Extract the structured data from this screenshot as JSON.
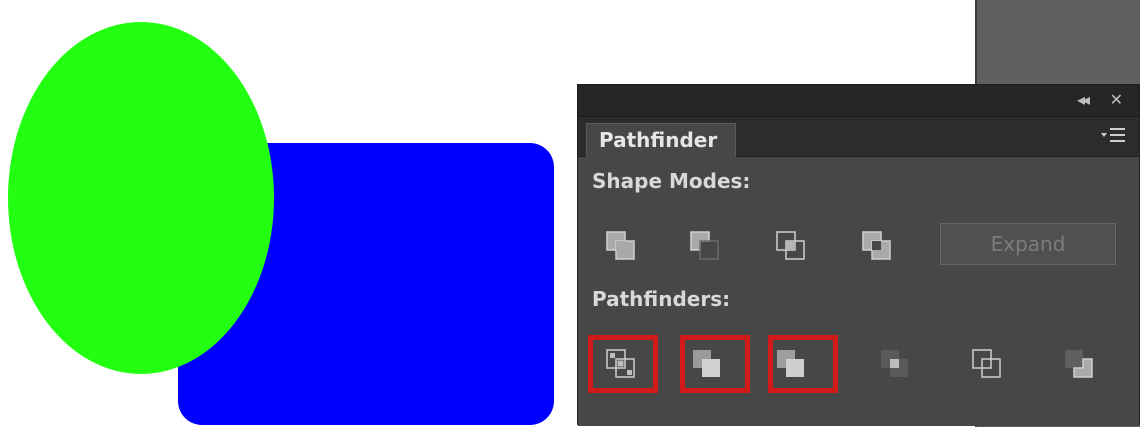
{
  "panel": {
    "tab_label": "Pathfinder",
    "shape_modes_label": "Shape Modes:",
    "pathfinders_label": "Pathfinders:",
    "expand_label": "Expand",
    "titlebar_icons": [
      "collapse-icon",
      "close-icon"
    ],
    "menu_icon": "panel-menu-icon",
    "shape_mode_icons": [
      "unite-icon",
      "minus-front-icon",
      "intersect-icon",
      "exclude-icon"
    ],
    "pathfinder_icons": [
      "divide-icon",
      "trim-icon",
      "merge-icon",
      "crop-icon",
      "outline-icon",
      "minus-back-icon"
    ],
    "highlighted_pathfinders": [
      "divide-icon",
      "trim-icon",
      "merge-icon"
    ]
  },
  "artboard": {
    "shapes": [
      {
        "name": "green-ellipse",
        "color": "#22ff11"
      },
      {
        "name": "blue-rounded-rectangle",
        "color": "#0000ff"
      }
    ]
  },
  "colors": {
    "highlight": "#d11a1a",
    "panel_bg": "#474747",
    "titlebar_bg": "#262626"
  }
}
